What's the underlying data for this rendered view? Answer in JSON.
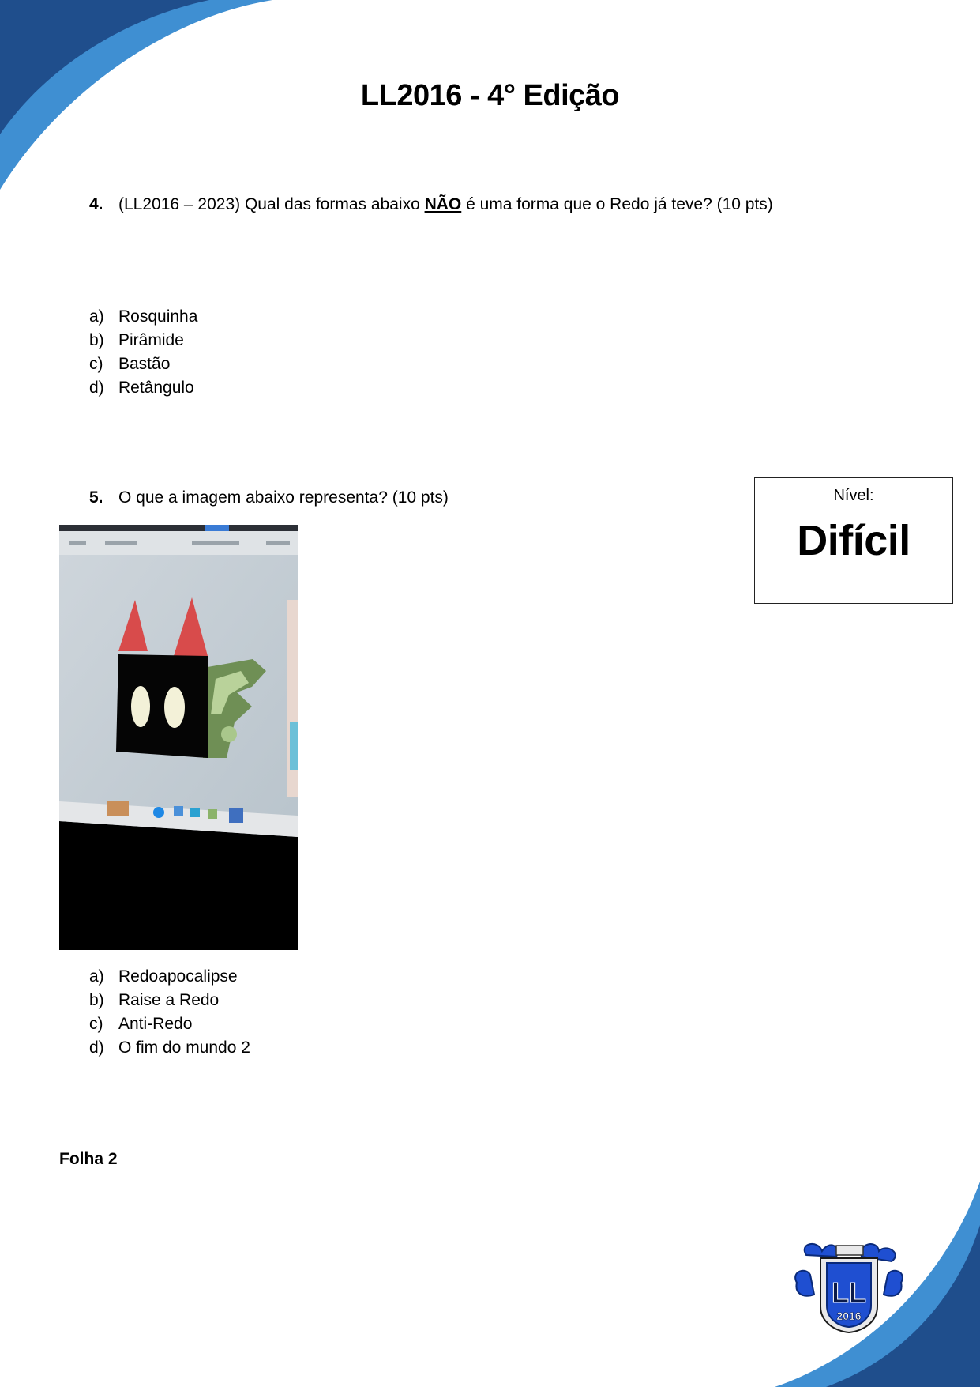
{
  "header": {
    "title": "LL2016 - 4° Edição"
  },
  "question4": {
    "number": "4.",
    "text_before": "(LL2016 – 2023) Qual das formas abaixo ",
    "emphasis": "NÃO",
    "text_after": " é uma forma que o Redo já teve? (10 pts)",
    "options": [
      {
        "letter": "a)",
        "text": "Rosquinha"
      },
      {
        "letter": "b)",
        "text": "Pirâmide"
      },
      {
        "letter": "c)",
        "text": "Bastão"
      },
      {
        "letter": "d)",
        "text": "Retângulo"
      }
    ]
  },
  "question5": {
    "number": "5.",
    "text": "O que a imagem abaixo representa? (10 pts)",
    "options": [
      {
        "letter": "a)",
        "text": "Redoapocalipse"
      },
      {
        "letter": "b)",
        "text": "Raise a Redo"
      },
      {
        "letter": "c)",
        "text": "Anti-Redo"
      },
      {
        "letter": "d)",
        "text": "O fim do mundo 2"
      }
    ]
  },
  "level": {
    "label": "Nível:",
    "value": "Difícil"
  },
  "footer": {
    "sheet": "Folha 2"
  },
  "logo": {
    "text_top": "LL",
    "text_bottom": "2016"
  },
  "colors": {
    "dark_blue": "#1f4e8c",
    "mid_blue": "#2e75b6",
    "light_blue": "#3f8fd2"
  }
}
